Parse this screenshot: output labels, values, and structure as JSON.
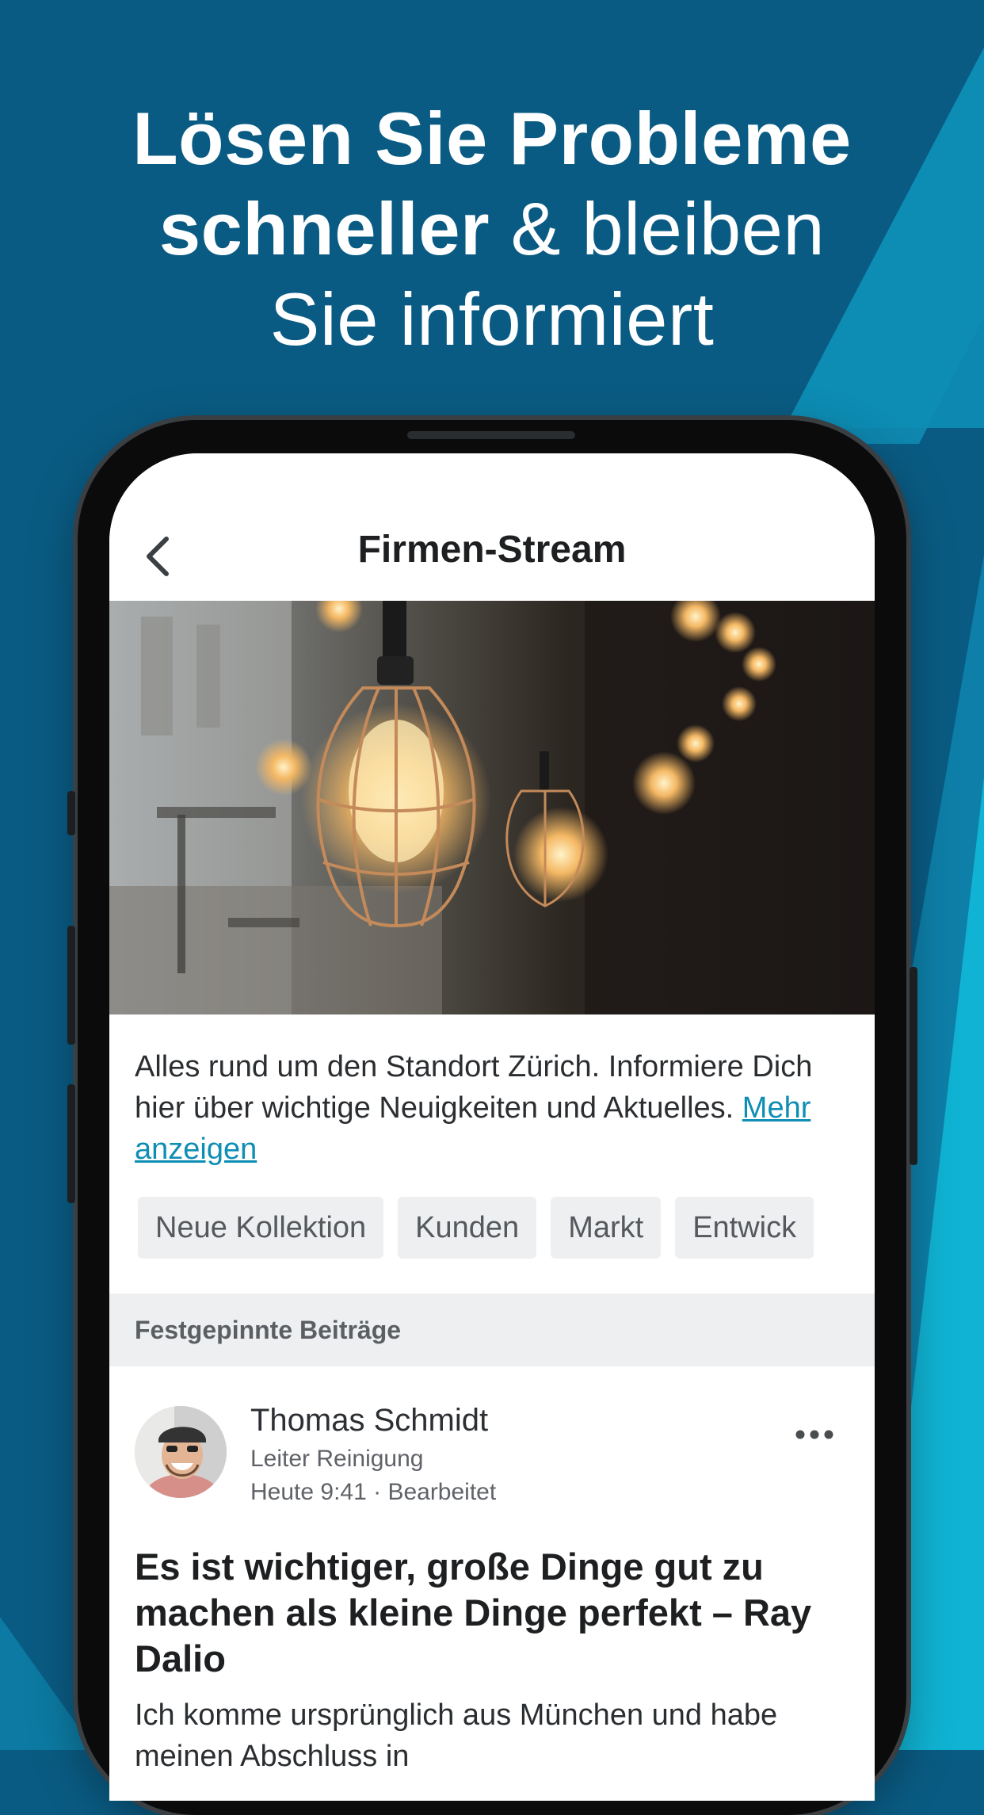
{
  "headline": {
    "line1": "Lösen Sie Probleme",
    "line2_bold": "schneller",
    "line2_rest": " & bleiben",
    "line3": "Sie informiert"
  },
  "nav": {
    "title": "Firmen-Stream",
    "back_icon": "chevron-left-icon"
  },
  "description": {
    "text": "Alles rund um den Standort Zürich. Informiere Dich hier über wichtige Neuigkeiten und Aktuelles. ",
    "more_link": "Mehr anzeigen"
  },
  "tags": [
    "Neue Kollektion",
    "Kunden",
    "Markt",
    "Entwick"
  ],
  "pinned": {
    "label": "Festgepinnte Beiträge"
  },
  "post": {
    "author": "Thomas Schmidt",
    "role": "Leiter Reinigung",
    "meta": "Heute 9:41 · Bearbeitet",
    "title": "Es ist wichtiger, große Dinge gut zu machen als kleine Dinge perfekt – Ray Dalio",
    "body": "Ich komme ursprünglich aus München und habe meinen Abschluss in"
  },
  "colors": {
    "background": "#0a5b83",
    "accent_stripe": "#0fa9c9",
    "link": "#0e8eb4"
  }
}
